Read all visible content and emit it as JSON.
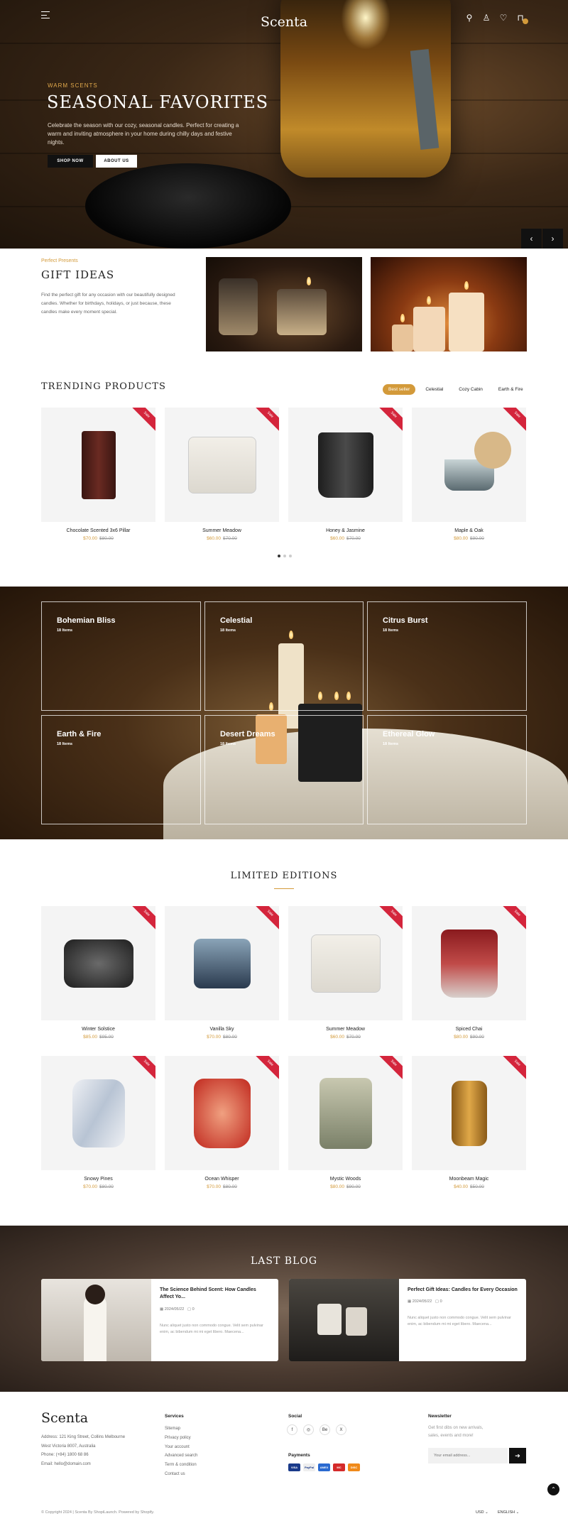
{
  "header": {
    "logo": "Scenta"
  },
  "hero": {
    "subtitle": "WARM SCENTS",
    "title": "SEASONAL FAVORITES",
    "description": "Celebrate the season with our cozy, seasonal candles. Perfect for creating a warm and inviting atmosphere in your home during chilly days and festive nights.",
    "shop_button": "SHOP NOW",
    "about_button": "ABOUT US",
    "prev": "‹",
    "next": "›"
  },
  "gift": {
    "subtitle": "Perfect Presents",
    "title": "GIFT IDEAS",
    "description": "Find the perfect gift for any occasion with our beautifully designed candles. Whether for birthdays, holidays, or just because, these candles make every moment special."
  },
  "trending": {
    "title": "TRENDING PRODUCTS",
    "tabs": [
      "Best seller",
      "Celestial",
      "Cozy Cabin",
      "Earth & Fire"
    ],
    "products": [
      {
        "name": "Chocolate Scented 3x6 Pillar",
        "price": "$70.00",
        "old": "$80.00",
        "sale": "Sale"
      },
      {
        "name": "Summer Meadow",
        "price": "$60.00",
        "old": "$70.00",
        "sale": "Sale"
      },
      {
        "name": "Honey & Jasmine",
        "price": "$60.00",
        "old": "$70.00",
        "sale": "Sale"
      },
      {
        "name": "Maple & Oak",
        "price": "$80.00",
        "old": "$90.00",
        "sale": "Sale"
      }
    ]
  },
  "collections": [
    {
      "name": "Bohemian Bliss",
      "count": "18 Items"
    },
    {
      "name": "Celestial",
      "count": "18 Items"
    },
    {
      "name": "Citrus Burst",
      "count": "18 Items"
    },
    {
      "name": "Earth & Fire",
      "count": "18 Items"
    },
    {
      "name": "Desert Dreams",
      "count": "18 Items"
    },
    {
      "name": "Ethereal Glow",
      "count": "18 Items"
    }
  ],
  "limited": {
    "title": "LIMITED EDITIONS",
    "products": [
      {
        "name": "Winter Solstice",
        "price": "$85.00",
        "old": "$95.00",
        "sale": "Sale"
      },
      {
        "name": "Vanilla Sky",
        "price": "$70.00",
        "old": "$80.00",
        "sale": "Sale"
      },
      {
        "name": "Summer Meadow",
        "price": "$60.00",
        "old": "$70.00",
        "sale": "Sale"
      },
      {
        "name": "Spiced Chai",
        "price": "$80.00",
        "old": "$90.00",
        "sale": "Sale"
      },
      {
        "name": "Snowy Pines",
        "price": "$70.00",
        "old": "$80.00",
        "sale": "Sale"
      },
      {
        "name": "Ocean Whisper",
        "price": "$70.00",
        "old": "$80.00",
        "sale": "Sale"
      },
      {
        "name": "Mystic Woods",
        "price": "$80.00",
        "old": "$90.00",
        "sale": "Sale"
      },
      {
        "name": "Moonbeam Magic",
        "price": "$40.00",
        "old": "$50.00",
        "sale": "Sale"
      }
    ]
  },
  "blog": {
    "title": "LAST BLOG",
    "posts": [
      {
        "title": "The Science Behind Scent: How Candles Affect Yo...",
        "date": "2024/05/22",
        "comments": "0",
        "excerpt": "Nunc aliquet justo non commodo congue. Velit sem pulvinar enim, ac bibendum mi mi eget libero. Maecena..."
      },
      {
        "title": "Perfect Gift Ideas: Candles for Every Occasion",
        "date": "2024/05/22",
        "comments": "0",
        "excerpt": "Nunc aliquet justo non commodo congue. Velit sem pulvinar enim, ac bibendum mi mi eget libero. Maecena..."
      }
    ]
  },
  "footer": {
    "logo": "Scenta",
    "address": [
      "Address: 121 King Street, Collins Melbourne",
      "West Victoria 8007, Australia",
      "Phone: (+84) 1800 68 86",
      "Email: hello@domain.com"
    ],
    "services_title": "Services",
    "services": [
      "Sitemap",
      "Privacy policy",
      "Your account",
      "Advanced search",
      "Term & condition",
      "Contact us"
    ],
    "social_title": "Social",
    "social": [
      "f",
      "◎",
      "Be",
      "X"
    ],
    "payments_title": "Payments",
    "payments": [
      "VISA",
      "PayPal",
      "AMEX",
      "MC",
      "DISC"
    ],
    "newsletter_title": "Newsletter",
    "newsletter_desc": "Get first dibs on new arrivals, sales, events and more!",
    "newsletter_placeholder": "Your email address...",
    "copyright": "© Copyright 2024 | Scenta By ShopiLaunch. Powered by Shopify.",
    "currency": "USD",
    "language": "ENGLISH"
  },
  "colors": {
    "accent": "#d39a3a",
    "sale": "#d4253c",
    "dark": "#111111"
  }
}
